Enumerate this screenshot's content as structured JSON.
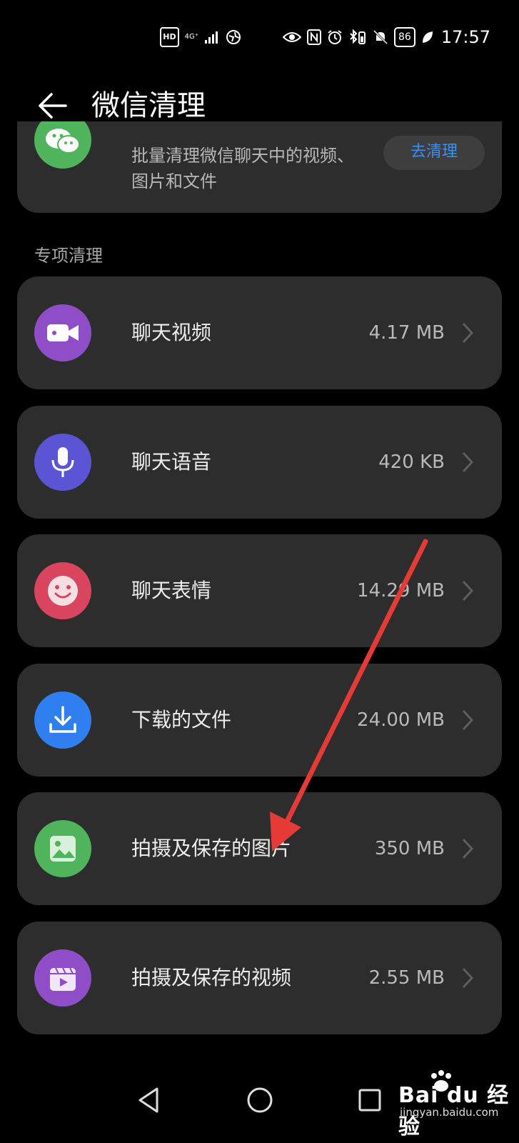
{
  "status_bar": {
    "hd": "HD",
    "network": "4G⁺",
    "battery": "86",
    "time": "17:57"
  },
  "header": {
    "title": "微信清理",
    "back_icon": "arrow-left-icon"
  },
  "top_card": {
    "description": "批量清理微信聊天中的视频、图片和文件",
    "button_label": "去清理"
  },
  "section": {
    "label": "专项清理"
  },
  "items": [
    {
      "label": "聊天视频",
      "size": "4.17 MB",
      "icon": "video-camera-icon",
      "color": "#8f4ec7"
    },
    {
      "label": "聊天语音",
      "size": "420 KB",
      "icon": "microphone-icon",
      "color": "#5b55d6"
    },
    {
      "label": "聊天表情",
      "size": "14.29 MB",
      "icon": "smiley-icon",
      "color": "#d9455f"
    },
    {
      "label": "下载的文件",
      "size": "24.00 MB",
      "icon": "download-icon",
      "color": "#2f7ff0"
    },
    {
      "label": "拍摄及保存的图片",
      "size": "350 MB",
      "icon": "image-icon",
      "color": "#4fb45b"
    },
    {
      "label": "拍摄及保存的视频",
      "size": "2.55 MB",
      "icon": "video-clip-icon",
      "color": "#8f4ec7"
    }
  ],
  "nav": {
    "back_icon": "triangle-back-icon",
    "home_icon": "circle-home-icon",
    "recents_icon": "square-recents-icon"
  },
  "watermark": {
    "main": "Bai du 经验",
    "sub": "jingyan.baidu.com"
  },
  "colors": {
    "background": "#000000",
    "card": "#2d2d2d",
    "accent": "#3d8ef3",
    "arrow": "#e53a35"
  }
}
